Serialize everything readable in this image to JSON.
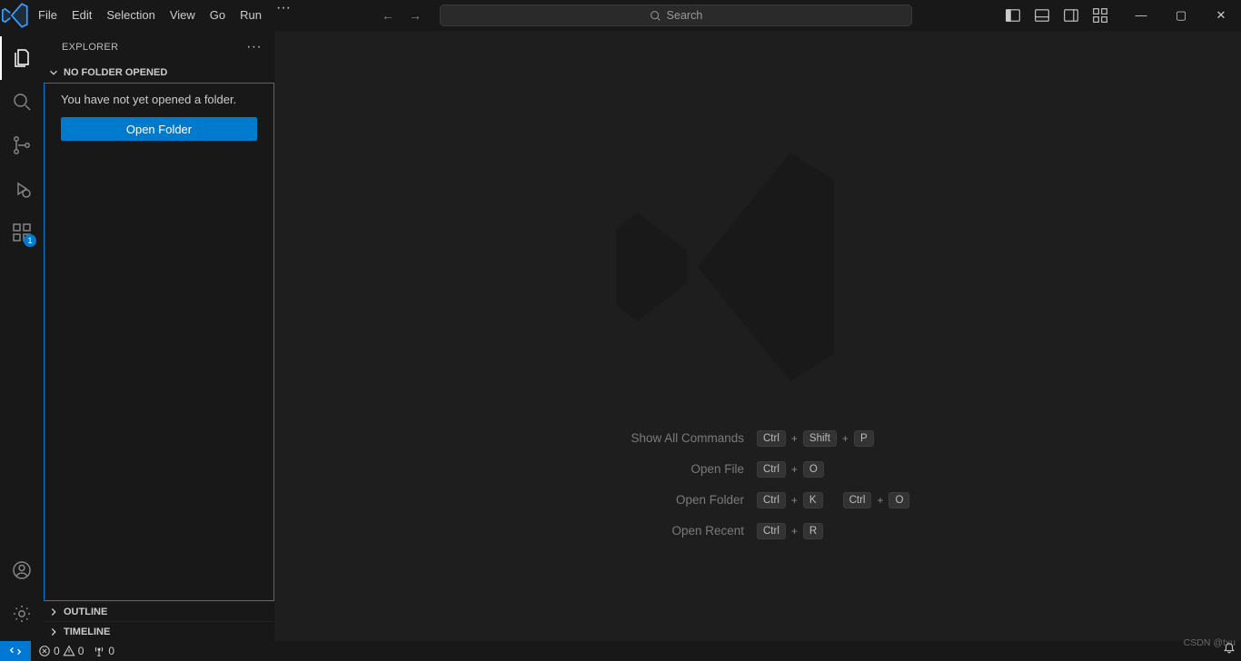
{
  "menu": {
    "items": [
      "File",
      "Edit",
      "Selection",
      "View",
      "Go",
      "Run"
    ],
    "more": "···"
  },
  "search": {
    "placeholder": "Search"
  },
  "sidebar": {
    "title": "EXPLORER",
    "section_header": "NO FOLDER OPENED",
    "no_folder_msg": "You have not yet opened a folder.",
    "open_folder_btn": "Open Folder",
    "outline": "OUTLINE",
    "timeline": "TIMELINE"
  },
  "activity": {
    "ext_badge": "1"
  },
  "watermark": {
    "items": [
      {
        "label": "Show All Commands",
        "keys": [
          [
            "Ctrl",
            "Shift",
            "P"
          ]
        ]
      },
      {
        "label": "Open File",
        "keys": [
          [
            "Ctrl",
            "O"
          ]
        ]
      },
      {
        "label": "Open Folder",
        "keys": [
          [
            "Ctrl",
            "K"
          ],
          [
            "Ctrl",
            "O"
          ]
        ]
      },
      {
        "label": "Open Recent",
        "keys": [
          [
            "Ctrl",
            "R"
          ]
        ]
      }
    ]
  },
  "status": {
    "errors": "0",
    "warnings": "0",
    "ports": "0"
  },
  "footer_mark": "CSDN @txu"
}
